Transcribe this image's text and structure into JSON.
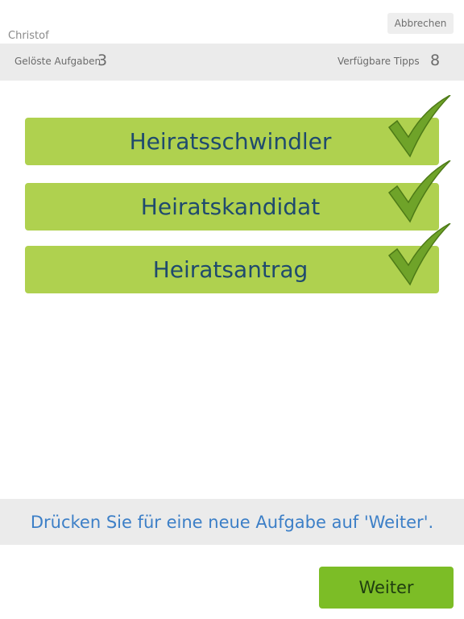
{
  "header": {
    "username": "Christof",
    "cancel_label": "Abbrechen"
  },
  "stats": {
    "solved_label": "Gelöste Aufgaben",
    "solved_value": "3",
    "tips_label": "Verfügbare Tipps",
    "tips_value": "8"
  },
  "answers": [
    {
      "label": "Heiratsschwindler",
      "correct": true
    },
    {
      "label": "Heiratskandidat",
      "correct": true
    },
    {
      "label": "Heiratsantrag",
      "correct": true
    }
  ],
  "hint": {
    "text": "Drücken Sie für eine neue Aufgabe auf 'Weiter'."
  },
  "footer": {
    "next_label": "Weiter"
  },
  "colors": {
    "answer_bg": "#afd14f",
    "answer_text": "#1f4a6e",
    "checkmark": "#6fa329",
    "hint_text": "#3c7fc7",
    "next_bg": "#7cbd26"
  }
}
